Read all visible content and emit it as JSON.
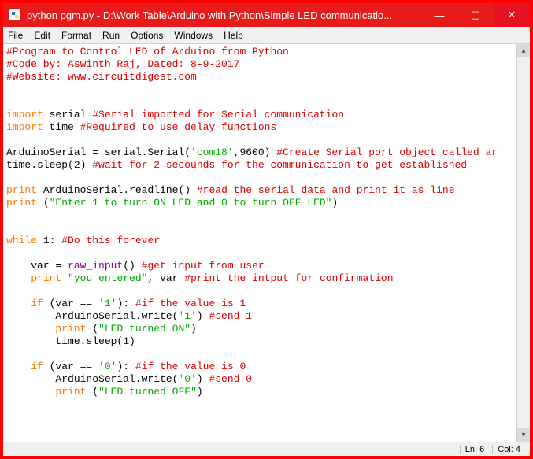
{
  "window": {
    "title": "python pgm.py - D:\\Work Table\\Arduino with Python\\Simple LED communicatio..."
  },
  "menu": {
    "file": "File",
    "edit": "Edit",
    "format": "Format",
    "run": "Run",
    "options": "Options",
    "windows": "Windows",
    "help": "Help"
  },
  "code": {
    "l1": "#Program to Control LED of Arduino from Python",
    "l2": "#Code by: Aswinth Raj, Dated: 8-9-2017",
    "l3": "#Website: www.circuitdigest.com",
    "l4": "",
    "l5": "",
    "l6a": "import",
    "l6b": " serial ",
    "l6c": "#Serial imported for Serial communication",
    "l7a": "import",
    "l7b": " time ",
    "l7c": "#Required to use delay functions",
    "l8": "",
    "l9a": "ArduinoSerial = serial.Serial(",
    "l9b": "'com18'",
    "l9c": ",9600) ",
    "l9d": "#Create Serial port object called ar",
    "l10a": "time.sleep(2) ",
    "l10b": "#wait for 2 secounds for the communication to get established",
    "l11": "",
    "l12a": "print",
    "l12b": " ArduinoSerial.readline() ",
    "l12c": "#read the serial data and print it as line",
    "l13a": "print",
    "l13b": " (",
    "l13c": "\"Enter 1 to turn ON LED and 0 to turn OFF LED\"",
    "l13d": ")",
    "l14": "",
    "l15": "",
    "l16a": "while",
    "l16b": " 1: ",
    "l16c": "#Do this forever",
    "l17": "",
    "l18a": "    var = ",
    "l18b": "raw_input",
    "l18c": "() ",
    "l18d": "#get input from user",
    "l19a": "    ",
    "l19b": "print",
    "l19c": " ",
    "l19d": "\"you entered\"",
    "l19e": ", var ",
    "l19f": "#print the intput for confirmation",
    "l20": "",
    "l21a": "    ",
    "l21b": "if",
    "l21c": " (var == ",
    "l21d": "'1'",
    "l21e": "): ",
    "l21f": "#if the value is 1",
    "l22a": "        ArduinoSerial.write(",
    "l22b": "'1'",
    "l22c": ") ",
    "l22d": "#send 1",
    "l23a": "        ",
    "l23b": "print",
    "l23c": " (",
    "l23d": "\"LED turned ON\"",
    "l23e": ")",
    "l24": "        time.sleep(1)",
    "l25": "",
    "l26a": "    ",
    "l26b": "if",
    "l26c": " (var == ",
    "l26d": "'0'",
    "l26e": "): ",
    "l26f": "#if the value is 0",
    "l27a": "        ArduinoSerial.write(",
    "l27b": "'0'",
    "l27c": ") ",
    "l27d": "#send 0",
    "l28a": "        ",
    "l28b": "print",
    "l28c": " (",
    "l28d": "\"LED turned OFF\"",
    "l28e": ")"
  },
  "status": {
    "ln": "Ln: 6",
    "col": "Col: 4"
  }
}
